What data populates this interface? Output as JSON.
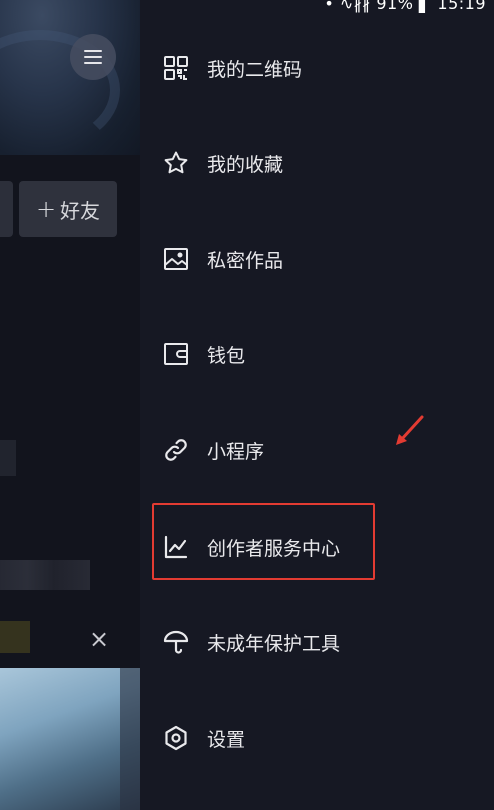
{
  "status_bar": {
    "text": "• ∿∦∦ 91% ▌ 15:19",
    "battery": "91%",
    "time": "15:19"
  },
  "background_page": {
    "add_friend_label": "好友",
    "add_friend_plus": "+",
    "close_glyph": "×",
    "menu_icon": "hamburger-icon"
  },
  "drawer": {
    "items": [
      {
        "label": "我的二维码",
        "icon": "qr-code-icon"
      },
      {
        "label": "我的收藏",
        "icon": "star-icon"
      },
      {
        "label": "私密作品",
        "icon": "private-image-icon"
      },
      {
        "label": "钱包",
        "icon": "wallet-icon"
      },
      {
        "label": "小程序",
        "icon": "link-icon"
      },
      {
        "label": "创作者服务中心",
        "icon": "chart-icon",
        "highlighted": true
      },
      {
        "label": "未成年保护工具",
        "icon": "umbrella-icon"
      },
      {
        "label": "设置",
        "icon": "settings-hexagon-icon"
      }
    ]
  },
  "colors": {
    "drawer_bg": "#161823",
    "text": "#e9e9ec",
    "highlight": "#e33b32"
  }
}
